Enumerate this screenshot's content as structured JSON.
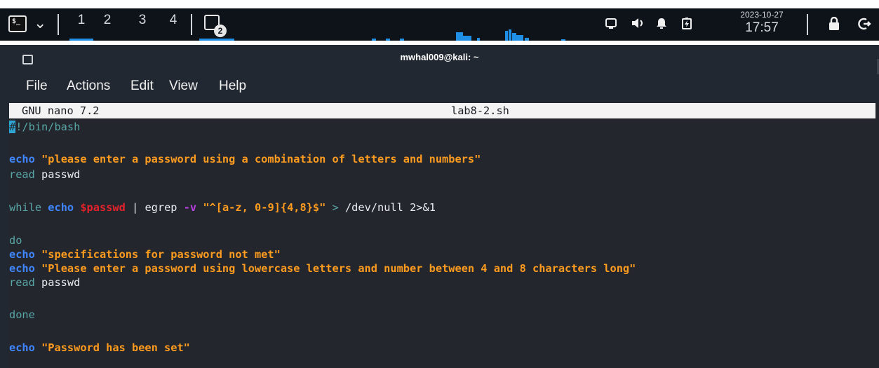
{
  "panel": {
    "workspaces": [
      "1",
      "2",
      "3",
      "4"
    ],
    "task_badge": "2",
    "date": "2023-10-27",
    "time": "17:57",
    "icons": [
      "terminal-launcher-icon",
      "chevron-down-icon",
      "terminal-task-icon",
      "display-icon",
      "volume-icon",
      "bell-icon",
      "battery-icon",
      "lock-icon",
      "logout-icon"
    ]
  },
  "window": {
    "title": "mwhal009@kali: ~",
    "menu": [
      "File",
      "Actions",
      "Edit",
      "View",
      "Help"
    ]
  },
  "nano": {
    "version": "GNU nano 7.2",
    "filename": "lab8-2.sh"
  },
  "code": {
    "shebang_hash": "#",
    "shebang_rest": "!/bin/bash",
    "l3_echo": "echo",
    "l3_str": "\"please enter a password using a combination of letters and numbers\"",
    "l4_read": "read",
    "l4_arg": " passwd",
    "l6_while": "while",
    "l6_echo": "echo",
    "l6_var": "$passwd",
    "l6_pipe": " | egrep ",
    "l6_opt": "-v",
    "l6_regex": "\"^[a-z, 0-9]{4,8}$\"",
    "l6_redirect": " > ",
    "l6_rest": "/dev/null 2>&1",
    "l8_do": "do",
    "l9_echo": "echo",
    "l9_str": "\"specifications for password not met\"",
    "l10_echo": "echo",
    "l10_str": "\"Please enter a password using lowercase letters and number between 4 and 8 characters long\"",
    "l11_read": "read",
    "l11_arg": " passwd",
    "l13_done": "done",
    "l15_echo": "echo",
    "l15_str": "\"Password has been set\""
  },
  "colors": {
    "panel_bg": "#0e1219",
    "terminal_bg": "#23262d",
    "accent_blue": "#1f8ee5",
    "keyword_echo": "#3f86ff",
    "string": "#ff9c1f",
    "variable": "#e5222b",
    "option": "#b83fe0",
    "builtin": "#59a6a6"
  }
}
